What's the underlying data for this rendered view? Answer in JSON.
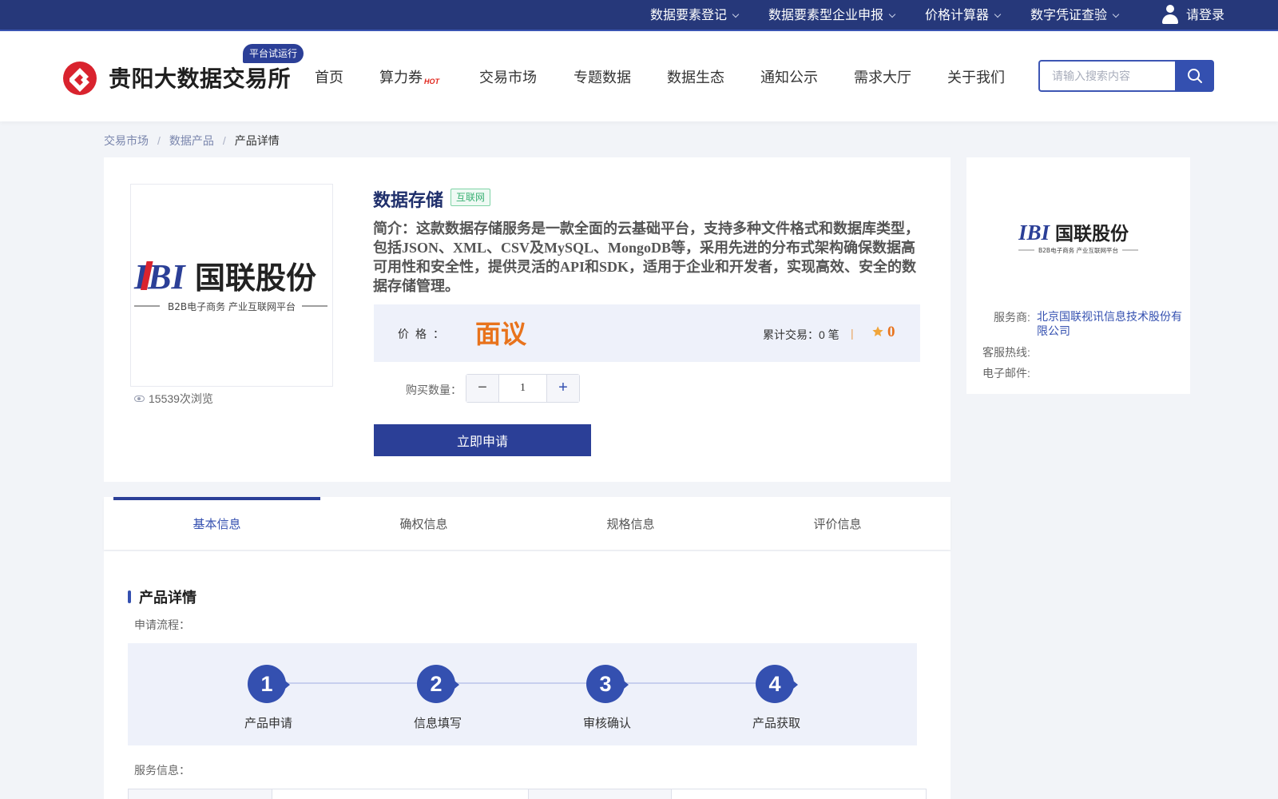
{
  "topbar": {
    "links": [
      "数据要素登记",
      "数据要素型企业申报",
      "价格计算器",
      "数字凭证查验"
    ],
    "login": "请登录"
  },
  "header": {
    "site_name": "贵阳大数据交易所",
    "trial_badge": "平台试运行",
    "nav": [
      "首页",
      "算力券",
      "交易市场",
      "专题数据",
      "数据生态",
      "通知公示",
      "需求大厅",
      "关于我们"
    ],
    "hot_tag": "HOT",
    "search_placeholder": "请输入搜索内容"
  },
  "breadcrumb": {
    "items": [
      "交易市场",
      "数据产品"
    ],
    "current": "产品详情",
    "separator": "/"
  },
  "product": {
    "logo_text": "国联股份",
    "logo_mark": "IBI",
    "logo_subtext": "B2B电子商务 产业互联网平台",
    "views": "15539次浏览",
    "title": "数据存储",
    "tag": "互联网",
    "intro": "简介：这款数据存储服务是一款全面的云基础平台，支持多种文件格式和数据库类型，包括JSON、XML、CSV及MySQL、MongoDB等，采用先进的分布式架构确保数据高可用性和安全性，提供灵活的API和SDK，适用于企业和开发者，实现高效、安全的数据存储管理。",
    "price_label": "价格：",
    "price_value": "面议",
    "trade_count": "累计交易：0 笔",
    "divider": "|",
    "rating": "0",
    "qty_label": "购买数量：",
    "qty_value": "1",
    "minus": "−",
    "plus": "+",
    "apply_button": "立即申请"
  },
  "vendor": {
    "logo_text": "国联股份",
    "logo_mark": "IBI",
    "logo_subtext": "B2B电子商务 产业互联网平台",
    "provider_label": "服务商:",
    "provider_value": "北京国联视讯信息技术股份有限公司",
    "hotline_label": "客服热线:",
    "email_label": "电子邮件:"
  },
  "tabs": [
    "基本信息",
    "确权信息",
    "规格信息",
    "评价信息"
  ],
  "detail": {
    "section_title": "产品详情",
    "process_label": "申请流程：",
    "steps": [
      {
        "num": "1",
        "label": "产品申请"
      },
      {
        "num": "2",
        "label": "信息填写"
      },
      {
        "num": "3",
        "label": "审核确认"
      },
      {
        "num": "4",
        "label": "产品获取"
      }
    ],
    "service_label": "服务信息："
  },
  "colors": {
    "primary": "#2b3f97",
    "accent": "#3450b0",
    "price": "#e8731c",
    "brand_red": "#d9232e"
  },
  "icons": [
    "user-icon",
    "chevron-down-icon",
    "search-icon",
    "eye-icon",
    "star-icon"
  ]
}
